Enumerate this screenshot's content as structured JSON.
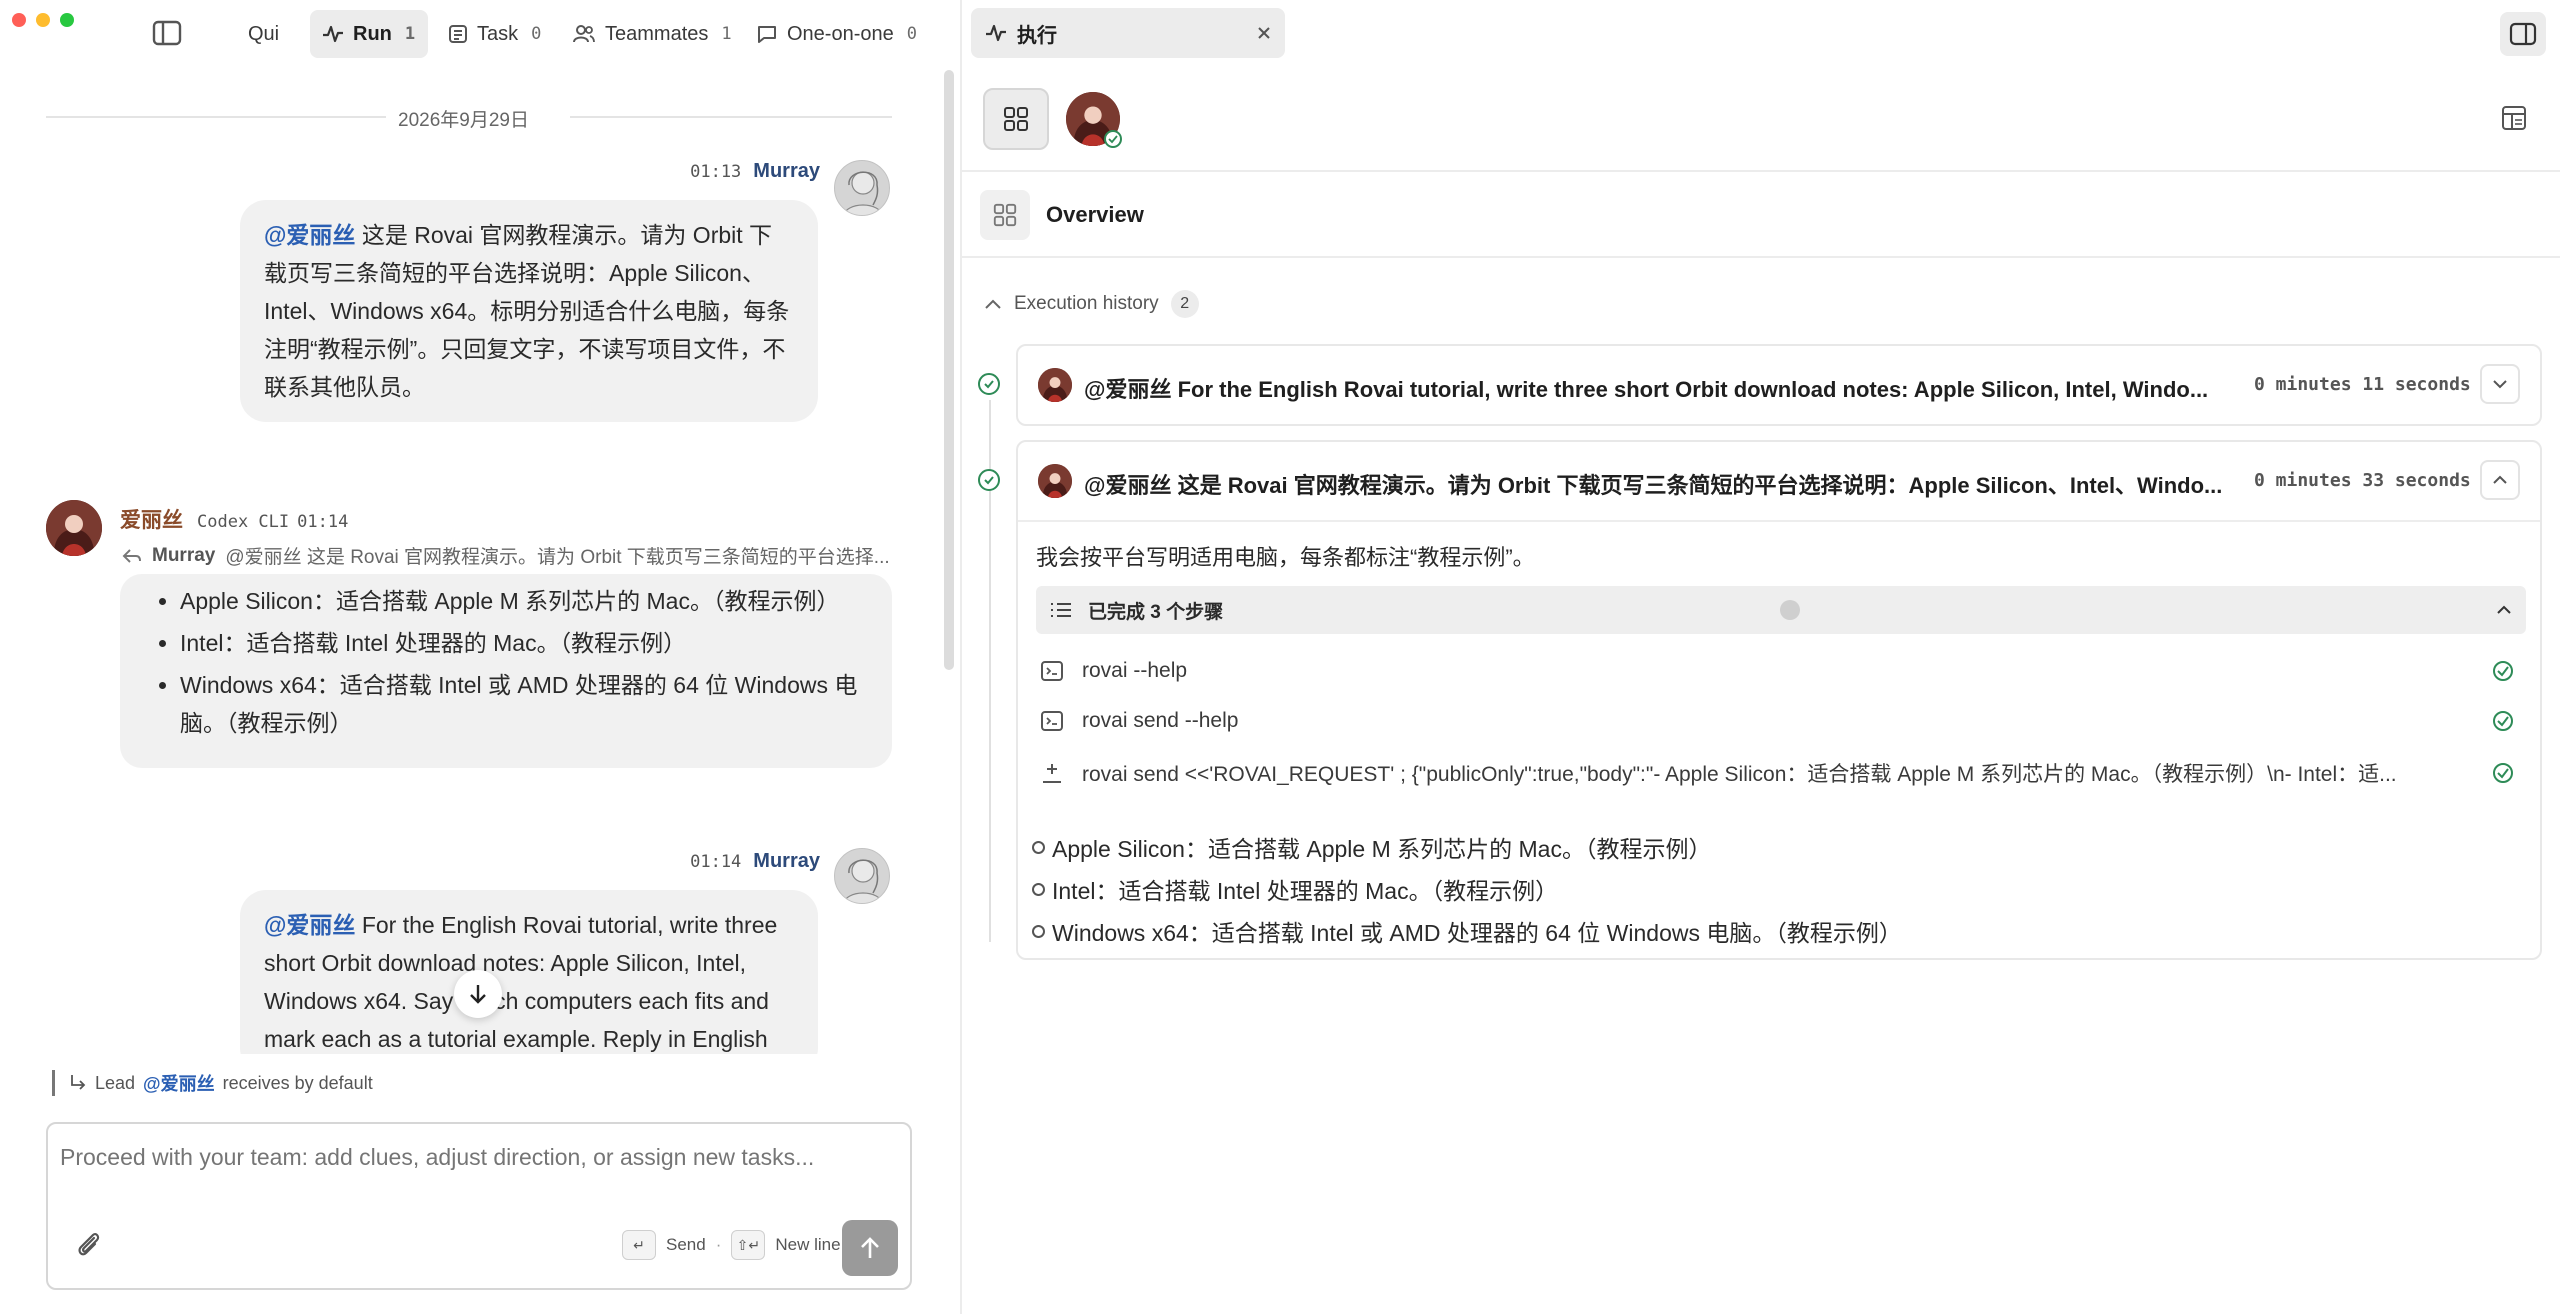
{
  "window": {
    "close_color": "#ff5f57",
    "minimize_color": "#febc2e",
    "maximize_color": "#28c840"
  },
  "left_tabs": [
    {
      "label": "Qui",
      "count": ""
    },
    {
      "label": "Run",
      "count": "1"
    },
    {
      "label": "Task",
      "count": "0"
    },
    {
      "label": "Teammates",
      "count": "1"
    },
    {
      "label": "One-on-one",
      "count": "0"
    }
  ],
  "chat": {
    "date": "2026年9月29日",
    "messages": [
      {
        "time": "01:13",
        "author": "Murray",
        "mention": "@爱丽丝",
        "text": " 这是 Rovai 官网教程演示。请为 Orbit 下载页写三条简短的平台选择说明：Apple Silicon、Intel、Windows x64。标明分别适合什么电脑，每条注明“教程示例”。只回复文字，不读写项目文件，不联系其他队员。"
      },
      {
        "author": "爱丽丝",
        "client": "Codex CLI",
        "time": "01:14",
        "reply_to_name": "Murray",
        "reply_to_text": "@爱丽丝 这是 Rovai 官网教程演示。请为 Orbit 下载页写三条简短的平台选择...",
        "bullets": [
          "Apple Silicon：适合搭载 Apple M 系列芯片的 Mac。（教程示例）",
          "Intel：适合搭载 Intel 处理器的 Mac。（教程示例）",
          "Windows x64：适合搭载 Intel 或 AMD 处理器的 64 位 Windows 电脑。（教程示例）"
        ]
      },
      {
        "time": "01:14",
        "author": "Murray",
        "mention": "@爱丽丝",
        "text": " For the English Rovai tutorial, write three short Orbit download notes: Apple Silicon, Intel, Windows x64. Say which computers each fits and mark each as a tutorial example. Reply in English"
      }
    ]
  },
  "recipient": {
    "prefix": "Lead",
    "mention": "@爱丽丝",
    "suffix": "receives by default"
  },
  "composer": {
    "placeholder": "Proceed with your team: add clues, adjust direction, or assign new tasks...",
    "send_key": "↵",
    "send_label": "Send",
    "separator": "·",
    "newline_key": "⇧↵",
    "newline_label": "New line"
  },
  "right": {
    "tab_title": "执行",
    "overview_label": "Overview",
    "history_label": "Execution history",
    "history_count": "2",
    "executions": [
      {
        "mention": "@爱丽丝",
        "title": "For the English Rovai tutorial, write three short Orbit download notes: Apple Silicon, Intel, Windo...",
        "duration": "0 minutes 11 seconds"
      },
      {
        "mention": "@爱丽丝",
        "title": "这是 Rovai 官网教程演示。请为 Orbit 下载页写三条简短的平台选择说明：Apple Silicon、Intel、Windo...",
        "duration": "0 minutes 33 seconds",
        "summary": "我会按平台写明适用电脑，每条都标注“教程示例”。",
        "steps_header": "已完成 3 个步骤",
        "steps": [
          {
            "icon": "terminal-icon",
            "text": "rovai --help"
          },
          {
            "icon": "terminal-icon",
            "text": "rovai send --help"
          },
          {
            "icon": "sparkle-icon",
            "text": "rovai send <<'ROVAI_REQUEST' ; {\"publicOnly\":true,\"body\":\"- Apple Silicon：适合搭载 Apple M 系列芯片的 Mac。（教程示例）\\n- Intel：适..."
          }
        ],
        "bullets": [
          "Apple Silicon：适合搭载 Apple M 系列芯片的 Mac。（教程示例）",
          "Intel：适合搭载 Intel 处理器的 Mac。（教程示例）",
          "Windows x64：适合搭载 Intel 或 AMD 处理器的 64 位 Windows 电脑。（教程示例）"
        ]
      }
    ]
  },
  "colors": {
    "accent_blue": "#2b5fb3",
    "success_green": "#2e8b57",
    "author_brown": "#8a4b2a"
  }
}
